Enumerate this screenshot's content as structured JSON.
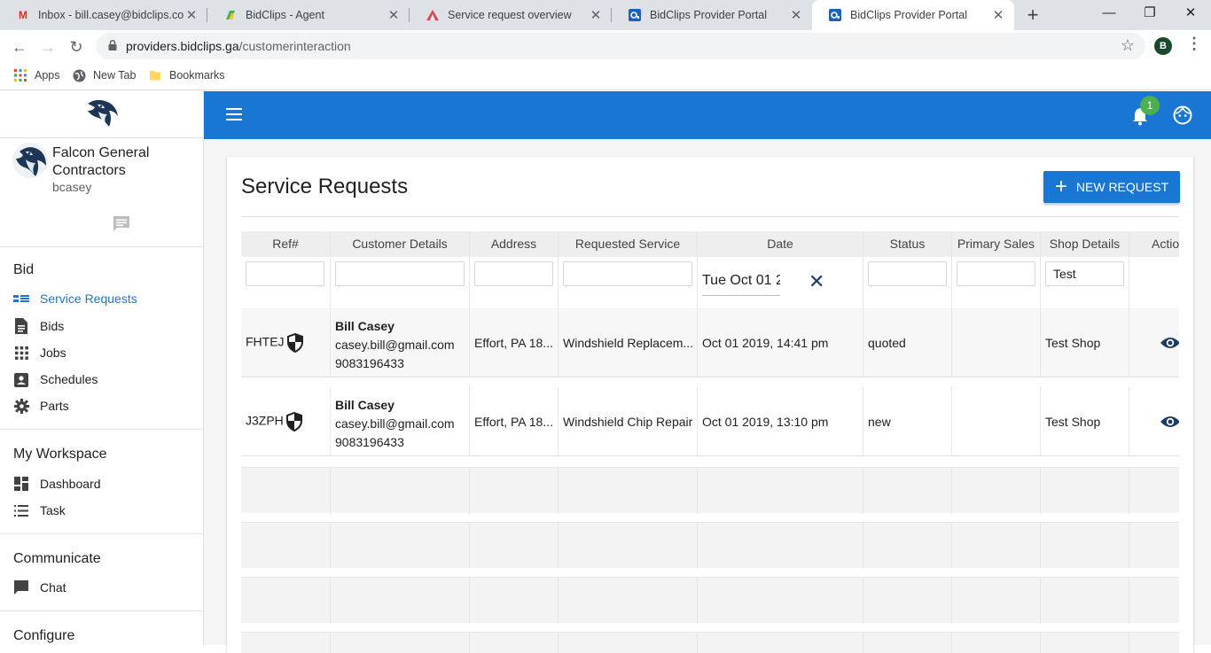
{
  "browser": {
    "tabs": [
      {
        "title": "Inbox - bill.casey@bidclips.com",
        "icon": "gmail-icon"
      },
      {
        "title": "BidClips - Agent",
        "icon": "bidclips-icon"
      },
      {
        "title": "Service request overview",
        "icon": "triangle-icon"
      },
      {
        "title": "BidClips Provider Portal",
        "icon": "portal-icon"
      },
      {
        "title": "BidClips Provider Portal",
        "icon": "portal-icon",
        "active": true
      }
    ],
    "new_tab_symbol": "+",
    "window_controls": {
      "minimize": "—",
      "maximize": "❐",
      "close": "✕"
    },
    "url_host": "providers.bidclips.ga",
    "url_path": "/customerinteraction",
    "profile_initial": "B",
    "bookmarks": [
      {
        "label": "Apps",
        "icon": "apps-grid-icon"
      },
      {
        "label": "New Tab",
        "icon": "globe-icon"
      },
      {
        "label": "Bookmarks",
        "icon": "folder-icon"
      }
    ]
  },
  "sidebar": {
    "org_name": "Falcon General Contractors",
    "username": "bcasey",
    "sections": [
      {
        "title": "Bid",
        "items": [
          {
            "label": "Service Requests",
            "icon": "list-icon",
            "active": true
          },
          {
            "label": "Bids",
            "icon": "document-icon"
          },
          {
            "label": "Jobs",
            "icon": "apps-icon"
          },
          {
            "label": "Schedules",
            "icon": "contact-card-icon"
          },
          {
            "label": "Parts",
            "icon": "gear-icon"
          }
        ]
      },
      {
        "title": "My Workspace",
        "items": [
          {
            "label": "Dashboard",
            "icon": "dashboard-icon"
          },
          {
            "label": "Task",
            "icon": "task-list-icon"
          }
        ]
      },
      {
        "title": "Communicate",
        "items": [
          {
            "label": "Chat",
            "icon": "chat-icon"
          }
        ]
      },
      {
        "title": "Configure",
        "items": []
      }
    ]
  },
  "appbar": {
    "notification_count": "1",
    "colors": {
      "primary": "#1976d2",
      "badge": "#4caf50"
    }
  },
  "main": {
    "title": "Service Requests",
    "new_request_label": "NEW REQUEST",
    "columns": [
      "Ref#",
      "Customer Details",
      "Address",
      "Requested Service",
      "Date",
      "Status",
      "Primary Sales",
      "Shop Details",
      "Actio"
    ],
    "filters": {
      "ref": "",
      "customer": "",
      "address": "",
      "service": "",
      "date": "Tue Oct 01 2",
      "status": "",
      "sales": "",
      "shop": "Test"
    },
    "rows": [
      {
        "ref": "FHTEJ",
        "customer_name": "Bill Casey",
        "customer_email": "casey.bill@gmail.com",
        "customer_phone": "9083196433",
        "address": "Effort, PA 18...",
        "service": "Windshield Replacem...",
        "date": "Oct 01 2019, 14:41 pm",
        "status": "quoted",
        "primary_sales": "",
        "shop": "Test Shop"
      },
      {
        "ref": "J3ZPH",
        "customer_name": "Bill Casey",
        "customer_email": "casey.bill@gmail.com",
        "customer_phone": "9083196433",
        "address": "Effort, PA 18...",
        "service": "Windshield Chip Repair",
        "date": "Oct 01 2019, 13:10 pm",
        "status": "new",
        "primary_sales": "",
        "shop": "Test Shop"
      }
    ]
  }
}
